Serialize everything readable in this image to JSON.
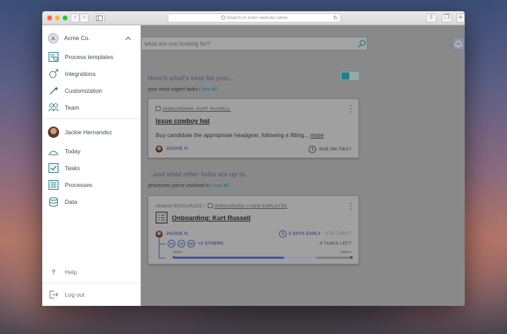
{
  "browser": {
    "url_placeholder": "Search or enter website name"
  },
  "sidebar": {
    "org": {
      "initial": "A",
      "name": "Acme Co."
    },
    "org_items": [
      {
        "label": "Process templates",
        "icon": "process-templates-icon"
      },
      {
        "label": "Integrations",
        "icon": "integrations-icon"
      },
      {
        "label": "Customization",
        "icon": "customization-icon"
      },
      {
        "label": "Team",
        "icon": "team-icon"
      }
    ],
    "user": {
      "name": "Jackie Hernandez"
    },
    "user_items": [
      {
        "label": "Today",
        "icon": "today-icon"
      },
      {
        "label": "Tasks",
        "icon": "tasks-icon"
      },
      {
        "label": "Processes",
        "icon": "processes-icon"
      },
      {
        "label": "Data",
        "icon": "data-icon"
      }
    ],
    "help": {
      "label": "Help",
      "glyph": "?"
    },
    "logout": {
      "label": "Log out"
    }
  },
  "main": {
    "search_placeholder": "what are you looking for?",
    "next": {
      "heading": "Here's what's next for you...",
      "subtitle": "your most urgent tasks /",
      "see_all": "see all",
      "task": {
        "breadcrumb": "ONBOARDING: KURT RUSSELL",
        "title": "Issue cowboy hat",
        "description": "Buy candidate the appropriate headgear, following a fitting...",
        "more": "more",
        "assignee": "JACKIE H.",
        "due": "DUE ON 7/9/17"
      }
    },
    "others": {
      "heading": "...and what other folks are up to.",
      "subtitle": "processes you're involved in /",
      "see_all": "see all",
      "process": {
        "category": "HUMAN RESOURCES /",
        "breadcrumb": "ONBOARDING A NEW EMPLOYEE",
        "title": "Onboarding: Kurt Russell",
        "owner": "JACKIE H.",
        "status": "3 DAYS EARLY",
        "eta": "- ETA 7/25/17",
        "participants": [
          "AH",
          "LB",
          "MK"
        ],
        "others": "+3 OTHERS",
        "tasks_left": "4 TASKS LEFT",
        "start_date": "6/2/17",
        "end_date": "7/28/17",
        "progress_done": 0.62,
        "progress_eta": 0.8
      }
    }
  },
  "colors": {
    "accent": "#2a7d88",
    "link": "#5a6ea8",
    "progress": "#3f55a0",
    "progress_light": "#8e99b9"
  }
}
